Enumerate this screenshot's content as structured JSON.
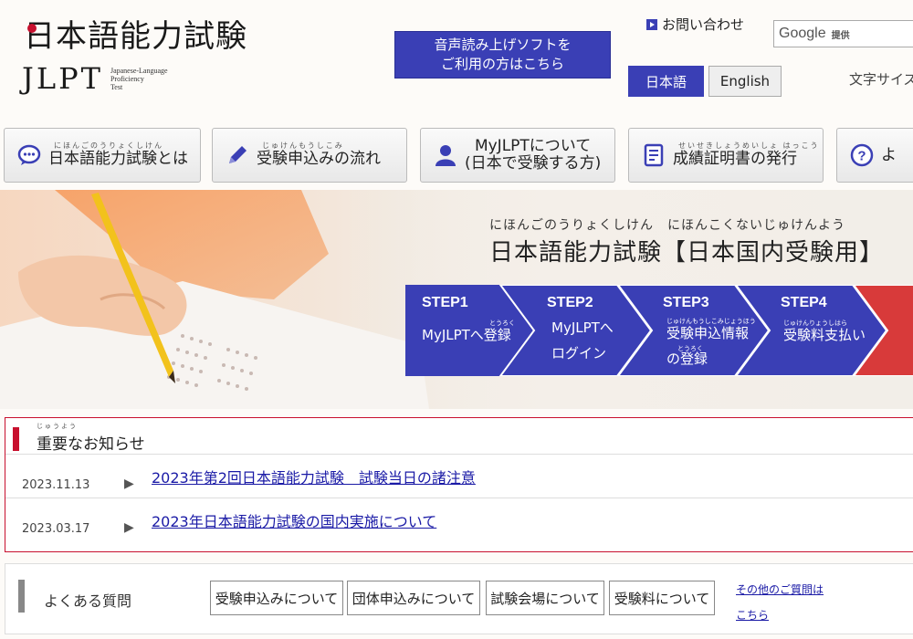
{
  "header": {
    "logo_jp": "日本語能力試験",
    "logo_jlpt": "JLPT",
    "logo_sub": [
      "Japanese-Language",
      "Proficiency",
      "Test"
    ],
    "tts_line1": "音声読み上げソフトを",
    "tts_line2": "ご利用の方はこちら",
    "contact": "お問い合わせ",
    "google_label": "Google",
    "google_provided": "提供",
    "lang_jp": "日本語",
    "lang_en": "English",
    "font_size_label": "文字サイズ"
  },
  "nav": [
    {
      "ruby": "にほんごのうりょくしけん",
      "label": "日本語能力試験とは",
      "icon": "speech-bubble-icon"
    },
    {
      "ruby": "じゅけんもうしこみ",
      "label": "受験申込みの流れ",
      "icon": "pencil-icon"
    },
    {
      "ruby": "",
      "label": "MyJLPTについて",
      "label2": "(日本で受験する方)",
      "icon": "person-icon"
    },
    {
      "ruby": "せいせきしょうめいしょ はっこう",
      "label": "成績証明書の発行",
      "icon": "document-icon"
    },
    {
      "ruby": "",
      "label": "よ",
      "icon": "question-icon"
    }
  ],
  "hero": {
    "ruby": "にほんごのうりょくしけん　にほんこくないじゅけんよう",
    "title": "日本語能力試験【日本国内受験用】",
    "steps": [
      {
        "label": "STEP1",
        "line1": "MyJLPTへ登録",
        "line2": ""
      },
      {
        "label": "STEP2",
        "line1": "MyJLPTへ",
        "line2": "ログイン"
      },
      {
        "label": "STEP3",
        "line1": "受験申込情報",
        "line2": "の登録"
      },
      {
        "label": "STEP4",
        "line1": "受験料支払い",
        "line2": ""
      }
    ],
    "step_colors": {
      "blue": "#3a3fb5",
      "red": "#d83a3a"
    }
  },
  "news": {
    "ruby": "じゅうよう",
    "title": "重要なお知らせ",
    "items": [
      {
        "date": "2023.11.13",
        "text": "2023年第2回日本語能力試験　試験当日の諸注意"
      },
      {
        "date": "2023.03.17",
        "text": "2023年日本語能力試験の国内実施について"
      }
    ]
  },
  "faq": {
    "title": "よくある質問",
    "buttons": [
      "受験申込みについて",
      "団体申込みについて",
      "試験会場について",
      "受験料について"
    ],
    "more_line1": "その他のご質問は",
    "more_line2": "こちら"
  }
}
